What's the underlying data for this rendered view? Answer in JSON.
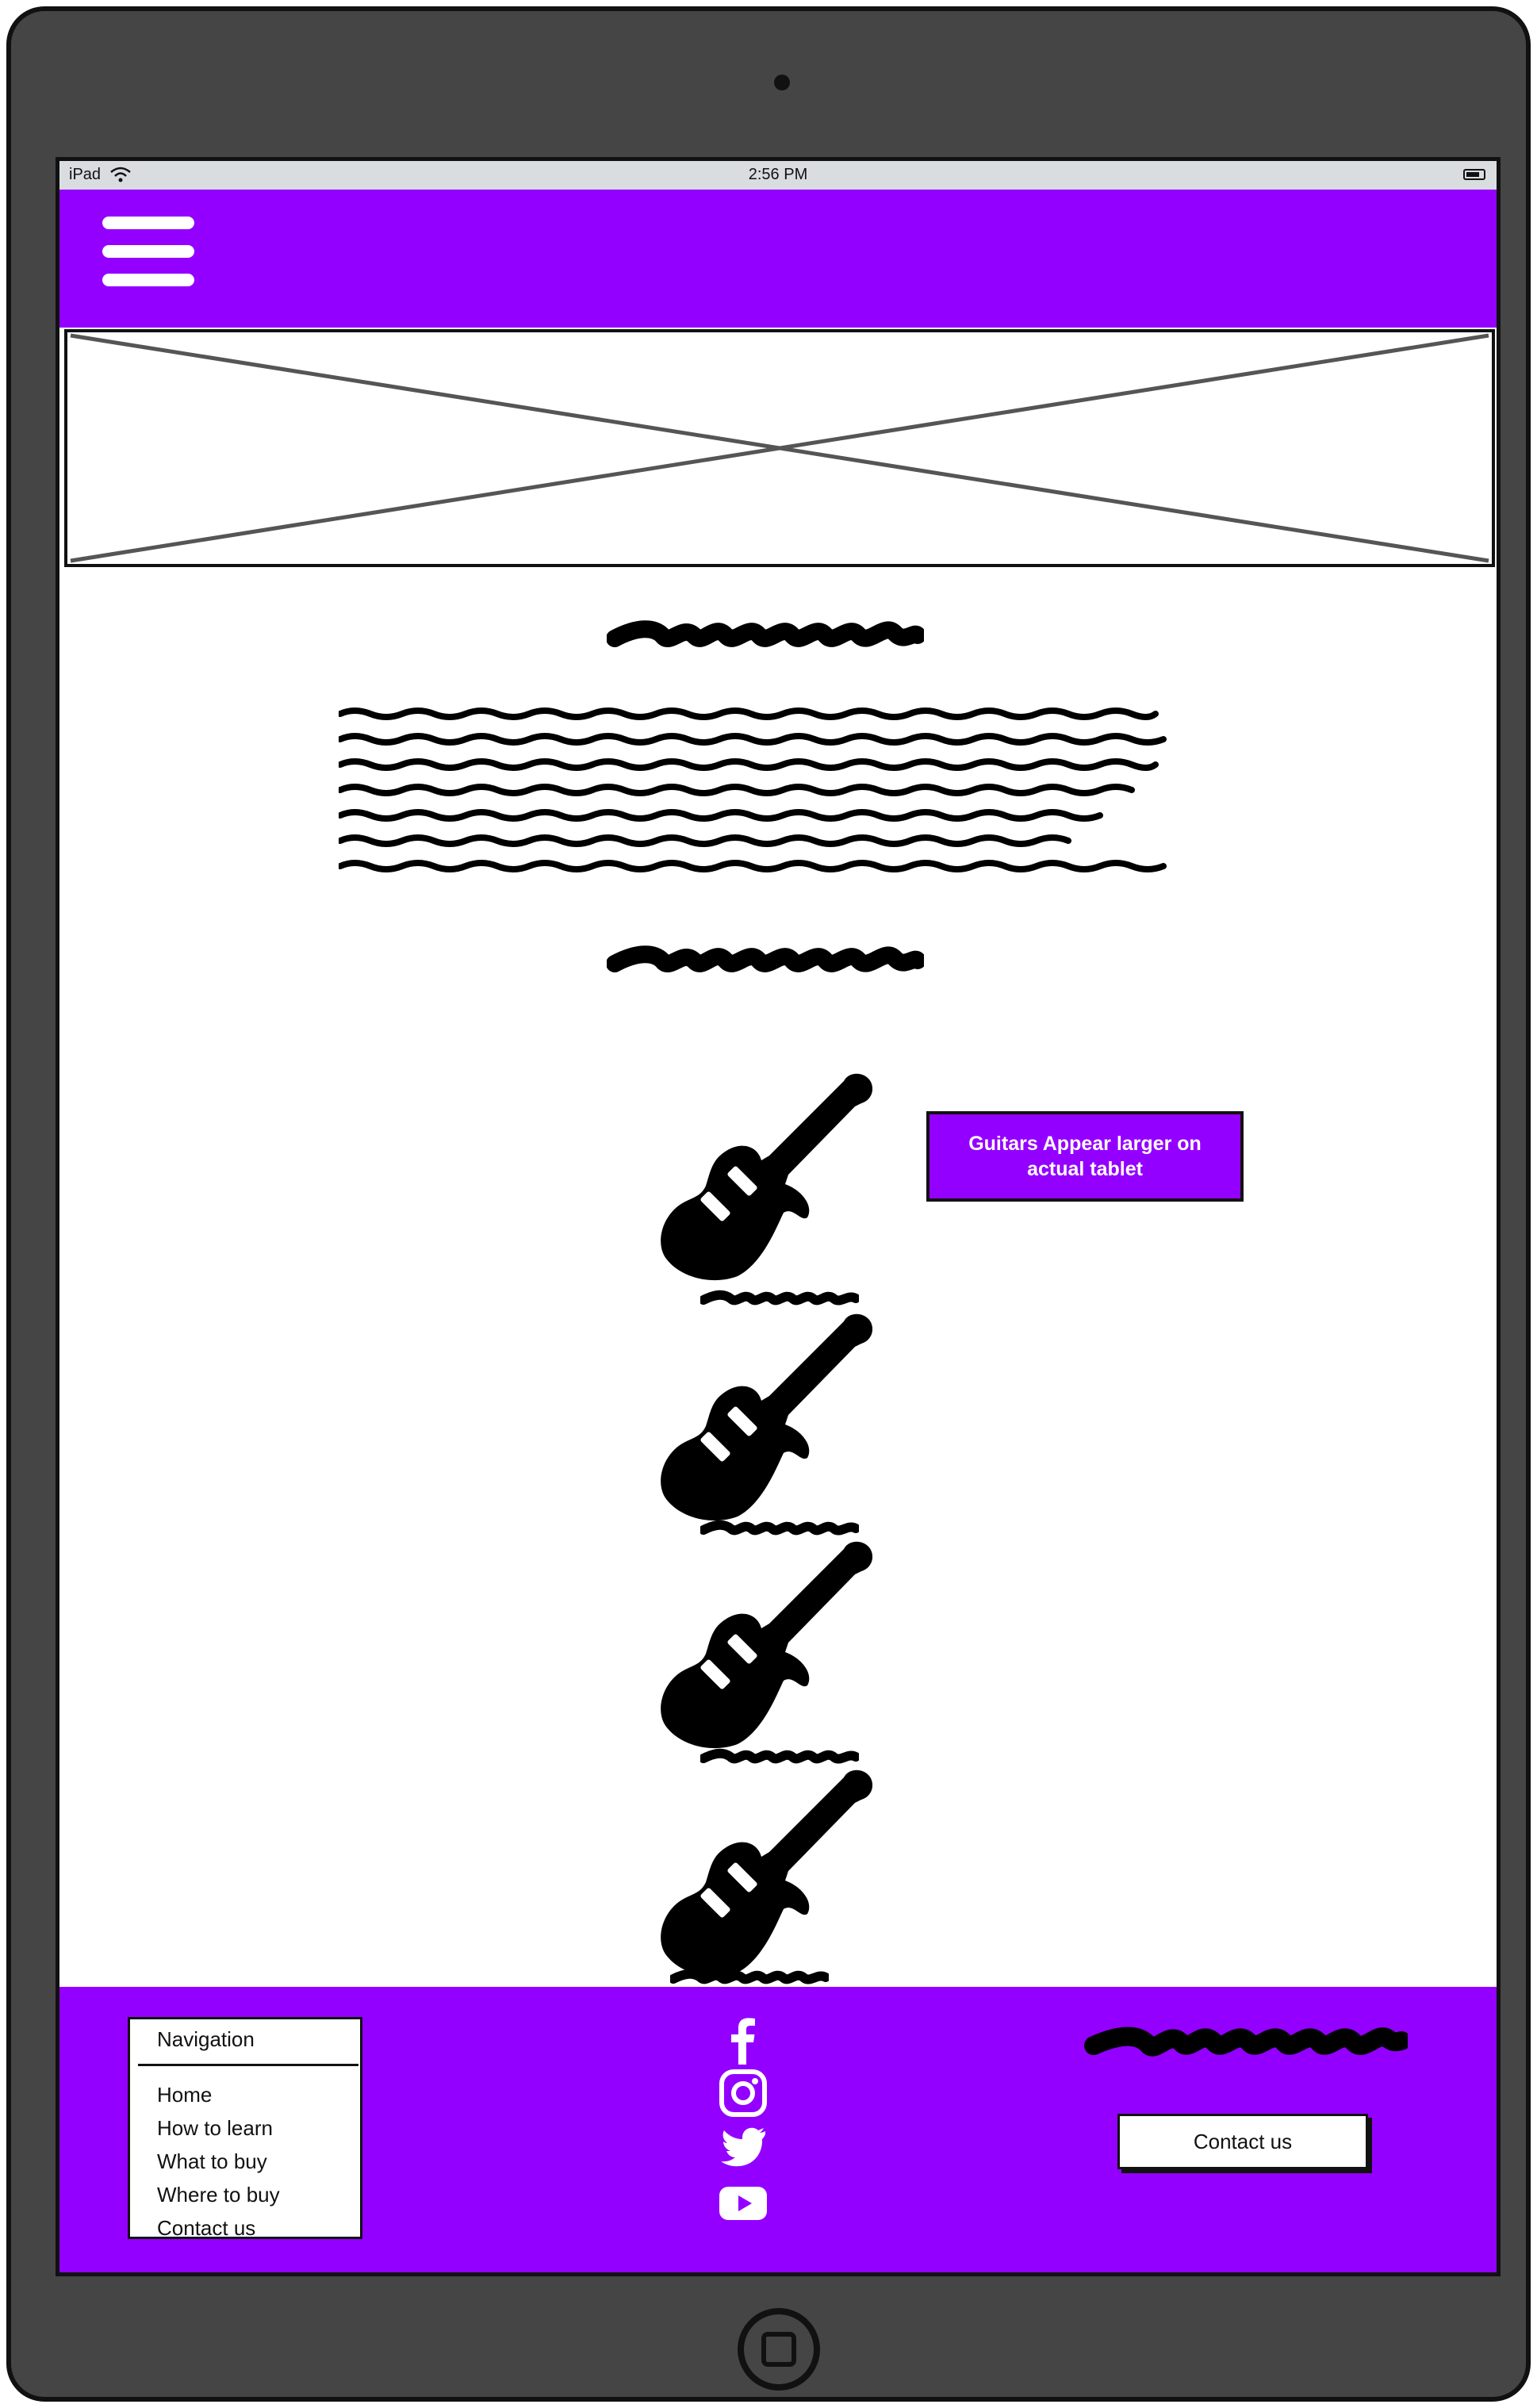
{
  "statusbar": {
    "carrier": "iPad",
    "time": "2:56 PM"
  },
  "callout": {
    "text": "Guitars Appear larger on actual tablet"
  },
  "footer": {
    "navigation": {
      "title": "Navigation",
      "items": [
        "Home",
        "How to learn",
        "What to buy",
        "Where to buy",
        "Contact us"
      ]
    },
    "social_icons": [
      "facebook-icon",
      "instagram-icon",
      "twitter-icon",
      "youtube-icon"
    ],
    "contact_button": "Contact us"
  },
  "colors": {
    "accent": "#9400ff",
    "device": "#454545",
    "ink": "#111111"
  }
}
